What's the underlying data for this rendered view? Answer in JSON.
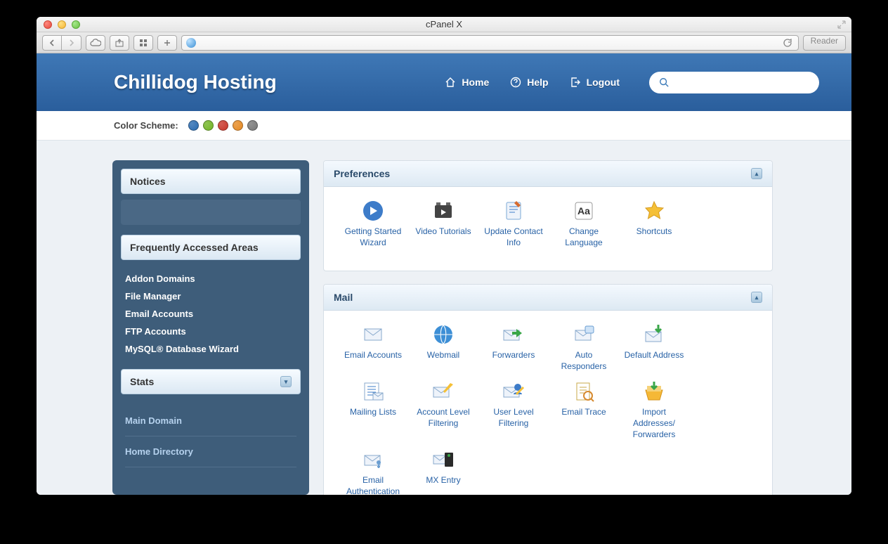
{
  "window": {
    "title": "cPanel X",
    "reader": "Reader"
  },
  "header": {
    "brand": "Chillidog Hosting",
    "nav": {
      "home": "Home",
      "help": "Help",
      "logout": "Logout"
    },
    "search_placeholder": ""
  },
  "colorbar": {
    "label": "Color Scheme:",
    "colors": [
      "#2a6bb0",
      "#72b426",
      "#c8362a",
      "#e68a23",
      "#777777"
    ]
  },
  "sidebar": {
    "notices": "Notices",
    "freq_head": "Frequently Accessed Areas",
    "freq_items": [
      "Addon Domains",
      "File Manager",
      "Email Accounts",
      "FTP Accounts",
      "MySQL® Database Wizard"
    ],
    "stats_head": "Stats",
    "stats_rows": [
      "Main Domain",
      "Home Directory"
    ]
  },
  "panels": {
    "preferences": {
      "title": "Preferences",
      "items": [
        "Getting Started Wizard",
        "Video Tutorials",
        "Update Contact Info",
        "Change Language",
        "Shortcuts"
      ]
    },
    "mail": {
      "title": "Mail",
      "items": [
        "Email Accounts",
        "Webmail",
        "Forwarders",
        "Auto Responders",
        "Default Address",
        "Mailing Lists",
        "Account Level Filtering",
        "User Level Filtering",
        "Email Trace",
        "Import Addresses/ Forwarders",
        "Email Authentication",
        "MX Entry"
      ]
    }
  }
}
